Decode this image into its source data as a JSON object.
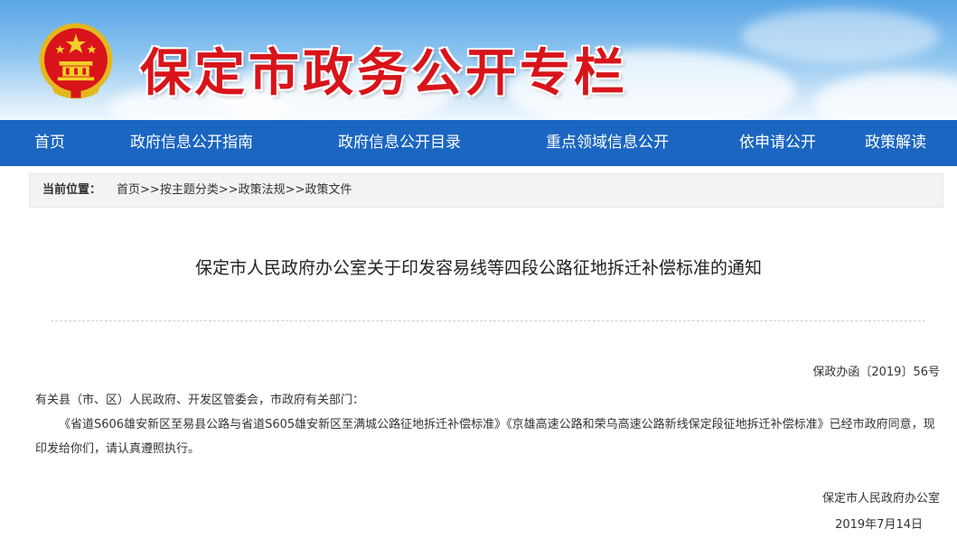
{
  "banner": {
    "title": "保定市政务公开专栏",
    "title_color": "#d8141a",
    "emblem_icon": "national-emblem-icon"
  },
  "nav": {
    "background": "#1b66c0",
    "items": [
      {
        "label": "首页"
      },
      {
        "label": "政府信息公开指南"
      },
      {
        "label": "政府信息公开目录"
      },
      {
        "label": "重点领域信息公开"
      },
      {
        "label": "依申请公开"
      },
      {
        "label": "政策解读"
      }
    ]
  },
  "breadcrumb": {
    "label": "当前位置：",
    "items": [
      "首页",
      "按主题分类",
      "政策法规",
      "政策文件"
    ],
    "separator": ">>"
  },
  "document": {
    "title": "保定市人民政府办公室关于印发容易线等四段公路征地拆迁补偿标准的通知",
    "number": "保政办函〔2019〕56号",
    "addressee": "有关县（市、区）人民政府、开发区管委会，市政府有关部门：",
    "body": "《省道S606雄安新区至易县公路与省道S605雄安新区至满城公路征地拆迁补偿标准》《京雄高速公路和荣乌高速公路新线保定段征地拆迁补偿标准》已经市政府同意，现印发给你们，请认真遵照执行。",
    "issuer": "保定市人民政府办公室",
    "date": "2019年7月14日"
  }
}
